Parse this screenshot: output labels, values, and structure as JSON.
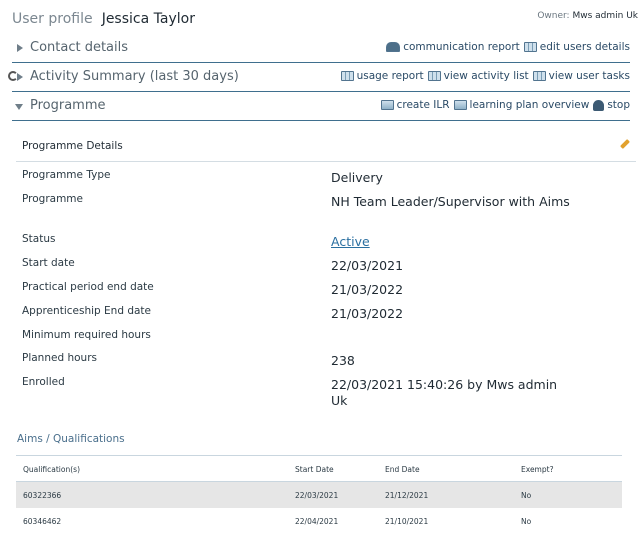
{
  "header": {
    "label": "User profile",
    "user_name": "Jessica Taylor",
    "owner_label": "Owner:",
    "owner_name": "Mws admin Uk"
  },
  "sections": {
    "contact": {
      "title": "Contact details",
      "links": {
        "communication_report": "communication report",
        "edit_user_details": "edit users details"
      }
    },
    "activity": {
      "title": "Activity Summary (last 30 days)",
      "links": {
        "usage_report": "usage report",
        "view_activity_list": "view activity list",
        "view_user_tasks": "view user tasks"
      }
    },
    "programme": {
      "title": "Programme",
      "links": {
        "create_ilr": "create ILR",
        "learning_plan_overview": "learning plan overview",
        "stop": "stop"
      }
    }
  },
  "programme_details": {
    "heading": "Programme Details",
    "rows": [
      {
        "key": "Programme Type",
        "value": "Delivery"
      },
      {
        "key": "Programme",
        "value": "NH Team Leader/Supervisor with Aims"
      },
      {
        "key": "Status",
        "value": "Active"
      },
      {
        "key": "Start date",
        "value": "22/03/2021"
      },
      {
        "key": "Practical period end date",
        "value": "21/03/2022"
      },
      {
        "key": "Apprenticeship End date",
        "value": "21/03/2022"
      },
      {
        "key": "Minimum required hours",
        "value": ""
      },
      {
        "key": "Planned hours",
        "value": "238"
      },
      {
        "key": "Enrolled",
        "value": "22/03/2021 15:40:26 by Mws admin Uk"
      }
    ]
  },
  "aims": {
    "title": "Aims / Qualifications",
    "columns": [
      "Qualification(s)",
      "Start Date",
      "End Date",
      "Exempt?"
    ],
    "rows": [
      [
        "60322366",
        "22/03/2021",
        "21/12/2021",
        "No"
      ],
      [
        "60346462",
        "22/04/2021",
        "21/10/2021",
        "No"
      ]
    ]
  },
  "icons": {
    "communication_report": "people-icon",
    "grid": "grid-icon",
    "stop": "stop-icon",
    "edit": "pencil-icon",
    "refresh": "refresh-icon"
  },
  "colors": {
    "section_rule": "#3f6f8e",
    "link": "#2a4a66",
    "status_link": "#2a6fa0",
    "aims_title": "#4a6f8c",
    "row_shade": "#e6e6e6"
  }
}
